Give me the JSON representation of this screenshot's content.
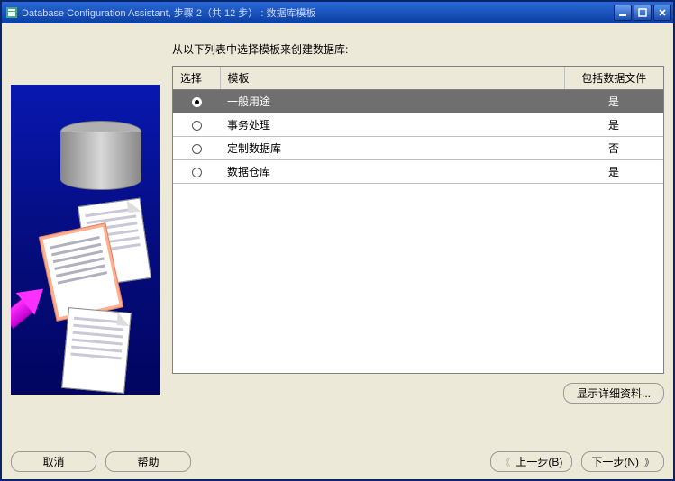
{
  "window": {
    "title": "Database Configuration Assistant, 步骤 2（共 12 步） : 数据库模板"
  },
  "instruction": "从以下列表中选择模板来创建数据库:",
  "table": {
    "headers": {
      "select": "选择",
      "template": "模板",
      "include": "包括数据文件"
    },
    "rows": [
      {
        "template": "一般用途",
        "include": "是",
        "selected": true
      },
      {
        "template": "事务处理",
        "include": "是",
        "selected": false
      },
      {
        "template": "定制数据库",
        "include": "否",
        "selected": false
      },
      {
        "template": "数据仓库",
        "include": "是",
        "selected": false
      }
    ]
  },
  "buttons": {
    "show_details": "显示详细资料...",
    "cancel": "取消",
    "help": "帮助",
    "back_prefix": "上一步(",
    "back_key": "B",
    "back_suffix": ")",
    "next_prefix": "下一步(",
    "next_key": "N",
    "next_suffix": ")"
  }
}
